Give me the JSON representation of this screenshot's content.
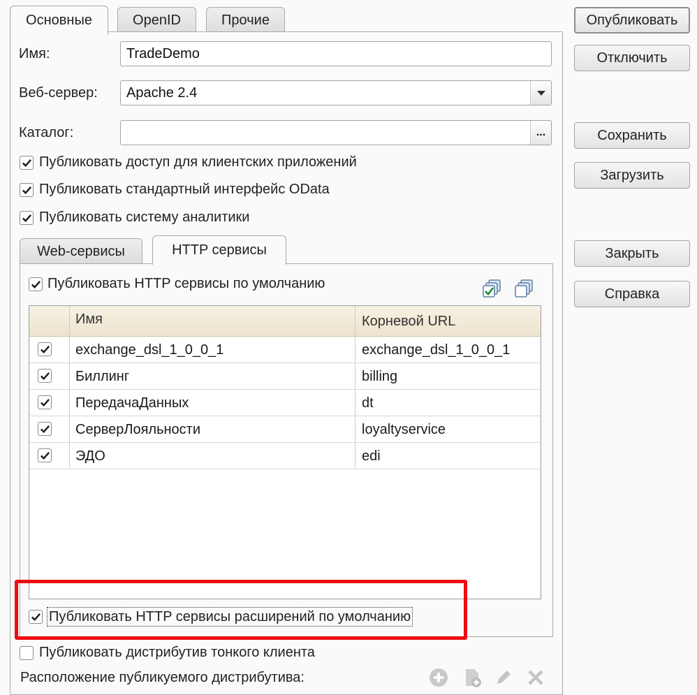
{
  "tabs": [
    "Основные",
    "OpenID",
    "Прочие"
  ],
  "form": {
    "name_label": "Имя:",
    "name_value": "TradeDemo",
    "webserver_label": "Веб-сервер:",
    "webserver_value": "Apache 2.4",
    "catalog_label": "Каталог:",
    "catalog_value": "",
    "catalog_button": "...",
    "checkboxes": [
      {
        "label": "Публиковать доступ для клиентских приложений",
        "checked": true
      },
      {
        "label": "Публиковать стандартный интерфейс OData",
        "checked": true
      },
      {
        "label": "Публиковать систему аналитики",
        "checked": true
      }
    ]
  },
  "inner_tabs": [
    "Web-сервисы",
    "HTTP сервисы"
  ],
  "http": {
    "default_label": "Публиковать HTTP сервисы по умолчанию",
    "default_checked": true,
    "columns": [
      "Имя",
      "Корневой URL"
    ],
    "rows": [
      {
        "checked": true,
        "name": "exchange_dsl_1_0_0_1",
        "url": "exchange_dsl_1_0_0_1"
      },
      {
        "checked": true,
        "name": "Биллинг",
        "url": "billing"
      },
      {
        "checked": true,
        "name": "ПередачаДанных",
        "url": "dt"
      },
      {
        "checked": true,
        "name": "СерверЛояльности",
        "url": "loyaltyservice"
      },
      {
        "checked": true,
        "name": "ЭДО",
        "url": "edi"
      }
    ],
    "extensions_label": "Публиковать HTTP сервисы расширений по умолчанию",
    "extensions_checked": true
  },
  "thin_client": {
    "label": "Публиковать дистрибутив тонкого клиента",
    "checked": false,
    "location_label": "Расположение публикуемого дистрибутива:"
  },
  "buttons": {
    "publish": "Опубликовать",
    "disable": "Отключить",
    "save": "Сохранить",
    "load": "Загрузить",
    "close": "Закрыть",
    "help": "Справка"
  },
  "colors": {
    "highlight": "#ee0a14",
    "header": "#ece4cf",
    "check": "#1a1a1a"
  }
}
